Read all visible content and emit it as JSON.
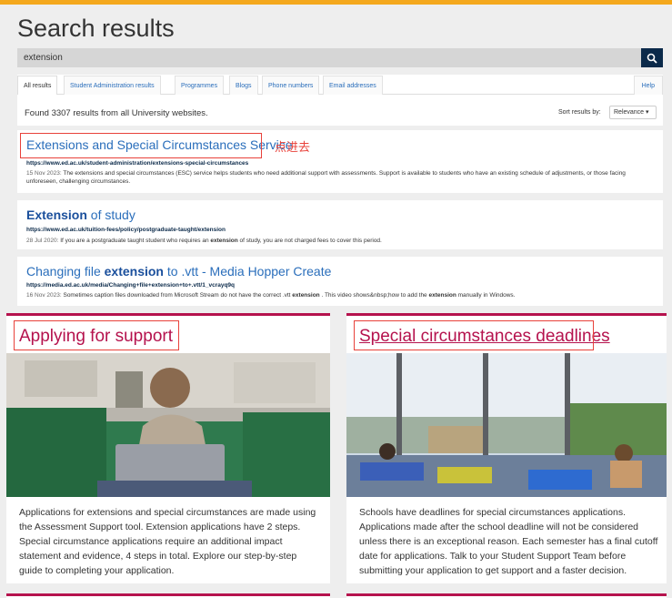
{
  "page": {
    "title": "Search results"
  },
  "search": {
    "value": "extension",
    "button_icon": "search-icon"
  },
  "tabs": [
    {
      "label": "All results",
      "active": true
    },
    {
      "label": "Student Administration results",
      "active": false
    },
    {
      "label": "Programmes",
      "active": false
    },
    {
      "label": "Blogs",
      "active": false
    },
    {
      "label": "Phone numbers",
      "active": false
    },
    {
      "label": "Email addresses",
      "active": false
    }
  ],
  "help_label": "Help",
  "summary": {
    "found_text": "Found 3307 results from all University websites.",
    "sort_label": "Sort results by:",
    "sort_value": "Relevance ▾"
  },
  "results": [
    {
      "title_bold": "",
      "title_rest": "Extensions and Special Circumstances Service",
      "url": "https://www.ed.ac.uk/student-administration/extensions-special-circumstances",
      "date": "15 Nov 2023:",
      "snippet": " The extensions and special circumstances (ESC) service helps students who need additional support with assessments. Support is available to students who have an existing schedule of adjustments, or those facing unforeseen, challenging circumstances."
    },
    {
      "title_bold": "Extension",
      "title_rest": " of study",
      "url": "https://www.ed.ac.uk/tuition-fees/policy/postgraduate-taught/extension",
      "date": "28 Jul 2020:",
      "snippet_a": " If you are a postgraduate taught student who requires an ",
      "snippet_bold": "extension",
      "snippet_b": " of study, you are not charged fees to cover this period."
    },
    {
      "title_a": "Changing file ",
      "title_bold": "extension",
      "title_b": " to .vtt - Media Hopper Create",
      "url": "https://media.ed.ac.uk/media/Changing+file+extension+to+.vtt/1_vcrayq9q",
      "date": "16 Nov 2023:",
      "snippet_a": " Sometimes caption files downloaded from Microsoft Stream do not have the correct .vtt ",
      "snippet_bold": "extension",
      "snippet_b": " . This video shows&nbsp;how to add the ",
      "snippet_bold2": "extension",
      "snippet_c": " manually in Windows."
    }
  ],
  "annotation": "点进去",
  "cards": [
    {
      "title": "Applying for support",
      "text_lines": [
        "Applications for extensions and special circumstances are made using",
        "the Assessment Support tool. Extension applications have 2 steps.",
        "Special circumstance applications require an additional impact",
        "statement and evidence, 4 steps in total. Explore our step-by-step",
        "guide to completing your application."
      ]
    },
    {
      "title": "Special circumstances deadlines",
      "text_lines": [
        "Schools have deadlines for special circumstances applications.",
        "Applications made after the school deadline will not be considered",
        "unless there is an exceptional reason. Each semester has a final cutoff",
        "date for applications. Talk to your Student Support Team before",
        "submitting your application to get support and a faster decision."
      ]
    }
  ],
  "colors": {
    "accent_bar": "#f4a81d",
    "link": "#2a6ebb",
    "card_accent": "#b5124d",
    "annotation": "#e8413a",
    "search_button": "#0b2a4a"
  }
}
